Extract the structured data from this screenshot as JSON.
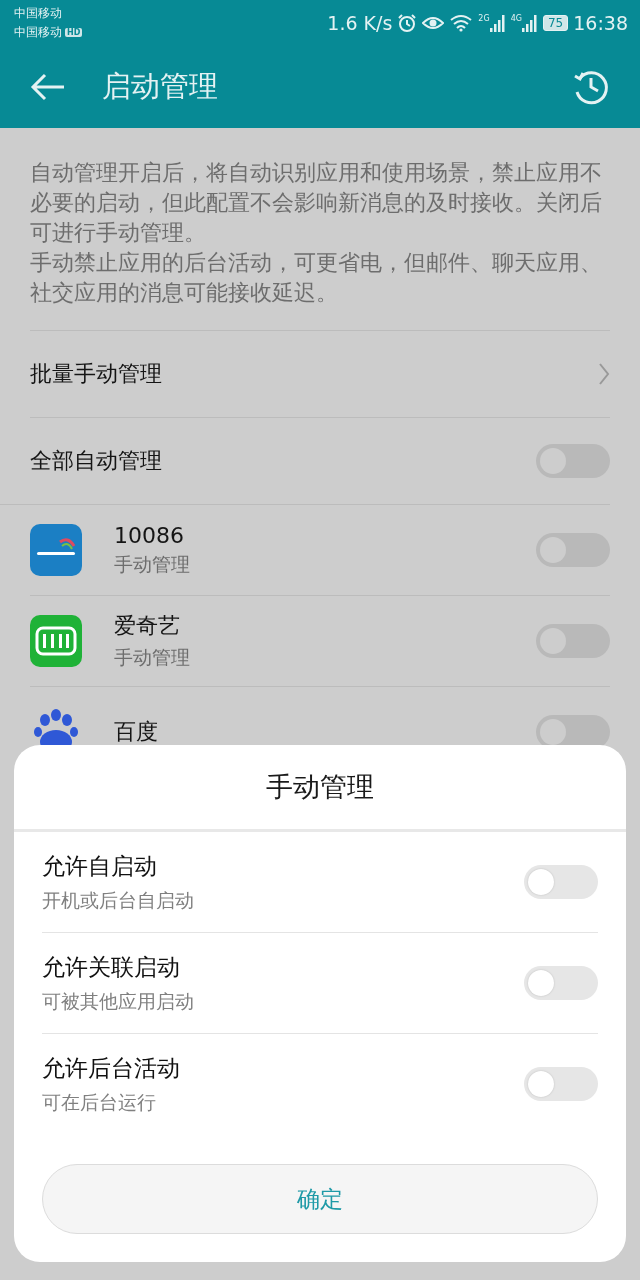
{
  "status_bar": {
    "carriers": [
      {
        "name": "中国移动",
        "hd": false
      },
      {
        "name": "中国移动",
        "hd": true
      }
    ],
    "hd_label": "HD",
    "speed": "1.6 K/s",
    "network_1": "2G",
    "network_2": "4G",
    "battery": "75",
    "time": "16:38"
  },
  "header": {
    "title": "启动管理"
  },
  "description": [
    "自动管理开启后，将自动识别应用和使用场景，禁止应用不必要的启动，但此配置不会影响新消息的及时接收。关闭后可进行手动管理。",
    "手动禁止应用的后台活动，可更省电，但邮件、聊天应用、社交应用的消息可能接收延迟。"
  ],
  "settings": [
    {
      "kind": "link",
      "label": "批量手动管理"
    },
    {
      "kind": "toggle",
      "label": "全部自动管理",
      "on": false
    }
  ],
  "apps": [
    {
      "kind": "mobile",
      "name": "10086",
      "subtitle": "手动管理",
      "on": false
    },
    {
      "kind": "video",
      "name": "爱奇艺",
      "subtitle": "手动管理",
      "on": false
    },
    {
      "kind": "paw",
      "name": "百度",
      "on": false
    }
  ],
  "dialog": {
    "title": "手动管理",
    "options": [
      {
        "label": "允许自启动",
        "hint": "开机或后台自启动",
        "on": false
      },
      {
        "label": "允许关联启动",
        "hint": "可被其他应用启动",
        "on": false
      },
      {
        "label": "允许后台活动",
        "hint": "可在后台运行",
        "on": false
      }
    ],
    "confirm": "确定"
  }
}
